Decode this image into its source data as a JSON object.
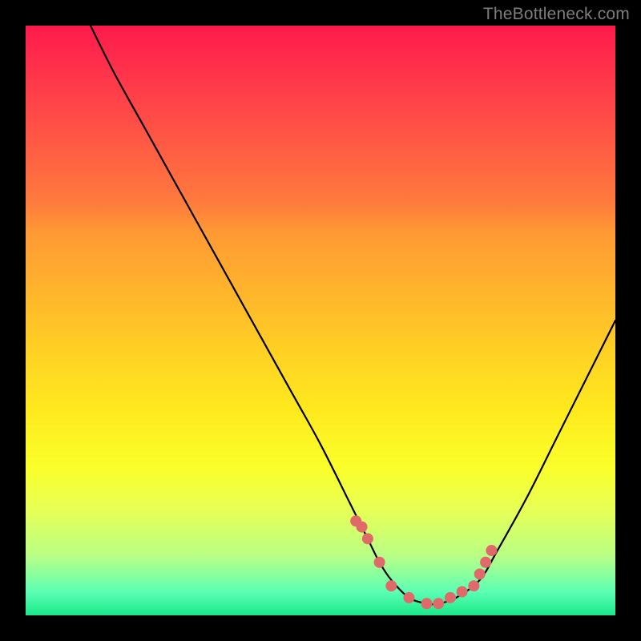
{
  "watermark": "TheBottleneck.com",
  "chart_data": {
    "type": "line",
    "title": "",
    "xlabel": "",
    "ylabel": "",
    "xlim": [
      0,
      100
    ],
    "ylim": [
      0,
      100
    ],
    "grid": false,
    "series": [
      {
        "name": "curve",
        "x": [
          11,
          15,
          20,
          25,
          30,
          35,
          40,
          45,
          50,
          55,
          58,
          60,
          62,
          65,
          68,
          70,
          73,
          77,
          80,
          85,
          90,
          95,
          100
        ],
        "y": [
          100,
          92,
          83,
          74,
          65,
          56,
          47,
          38,
          29,
          19,
          13,
          9,
          6,
          3,
          2,
          2,
          3,
          6,
          11,
          20,
          30,
          40,
          50
        ]
      }
    ],
    "markers": {
      "name": "dots",
      "color": "#e06a6a",
      "radius_px": 7,
      "x": [
        56,
        57,
        58,
        60,
        62,
        65,
        68,
        70,
        72,
        74,
        76,
        77,
        78,
        79
      ],
      "y": [
        16,
        15,
        13,
        9,
        5,
        3,
        2,
        2,
        3,
        4,
        5,
        7,
        9,
        11
      ]
    }
  }
}
